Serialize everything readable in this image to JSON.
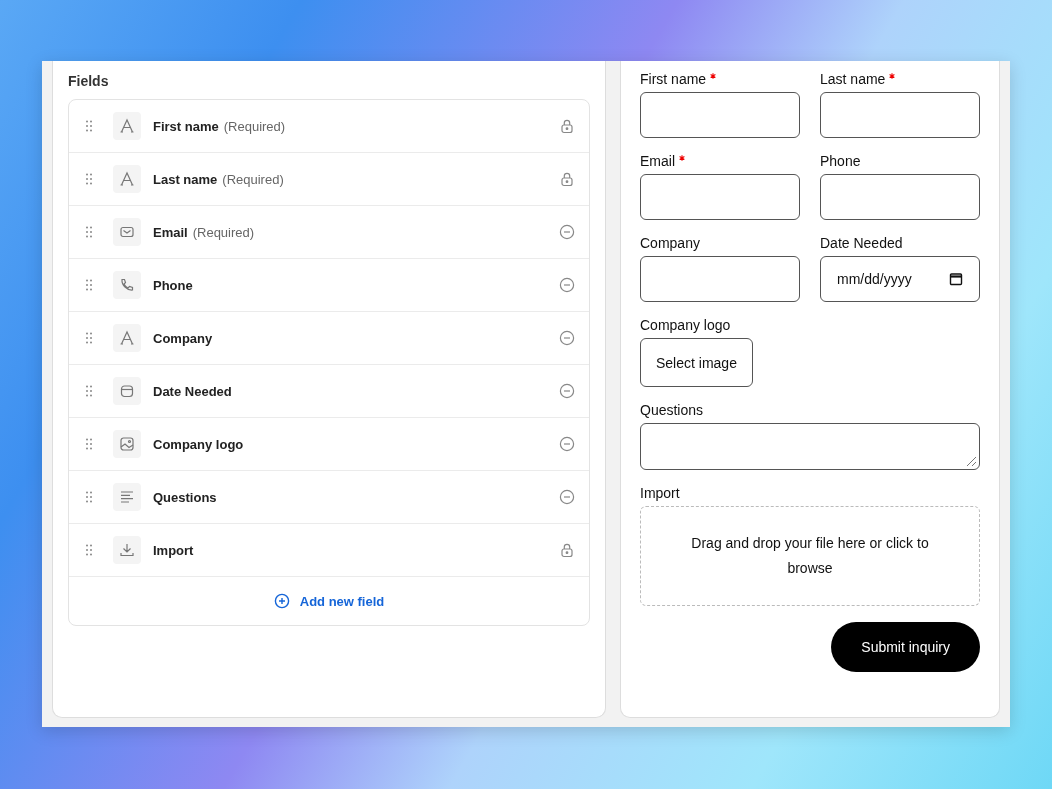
{
  "fields_panel": {
    "title": "Fields",
    "items": [
      {
        "kind": "text",
        "label": "First name",
        "note": "(Required)",
        "locked": true
      },
      {
        "kind": "text",
        "label": "Last name",
        "note": "(Required)",
        "locked": true
      },
      {
        "kind": "email",
        "label": "Email",
        "note": "(Required)",
        "locked": false
      },
      {
        "kind": "phone",
        "label": "Phone",
        "locked": false
      },
      {
        "kind": "text",
        "label": "Company",
        "locked": false
      },
      {
        "kind": "date",
        "label": "Date Needed",
        "locked": false
      },
      {
        "kind": "image",
        "label": "Company logo",
        "locked": false
      },
      {
        "kind": "paragraph",
        "label": "Questions",
        "locked": false
      },
      {
        "kind": "upload",
        "label": "Import",
        "locked": true
      }
    ],
    "add_button": "Add new field"
  },
  "form": {
    "fields": [
      {
        "kind": "input",
        "label": "First name",
        "required": true
      },
      {
        "kind": "input",
        "label": "Last name",
        "required": true
      },
      {
        "kind": "input",
        "label": "Email",
        "required": true
      },
      {
        "kind": "input",
        "label": "Phone",
        "required": false
      },
      {
        "kind": "input",
        "label": "Company",
        "required": false
      },
      {
        "kind": "date",
        "label": "Date Needed",
        "required": false,
        "placeholder": "mm/dd/yyyy"
      },
      {
        "kind": "image",
        "label": "Company logo",
        "required": false,
        "button": "Select image"
      },
      {
        "kind": "textarea",
        "label": "Questions",
        "required": false
      },
      {
        "kind": "upload",
        "label": "Import",
        "required": false,
        "text": "Drag and drop your file here or click to browse"
      }
    ],
    "submit": "Submit inquiry"
  }
}
